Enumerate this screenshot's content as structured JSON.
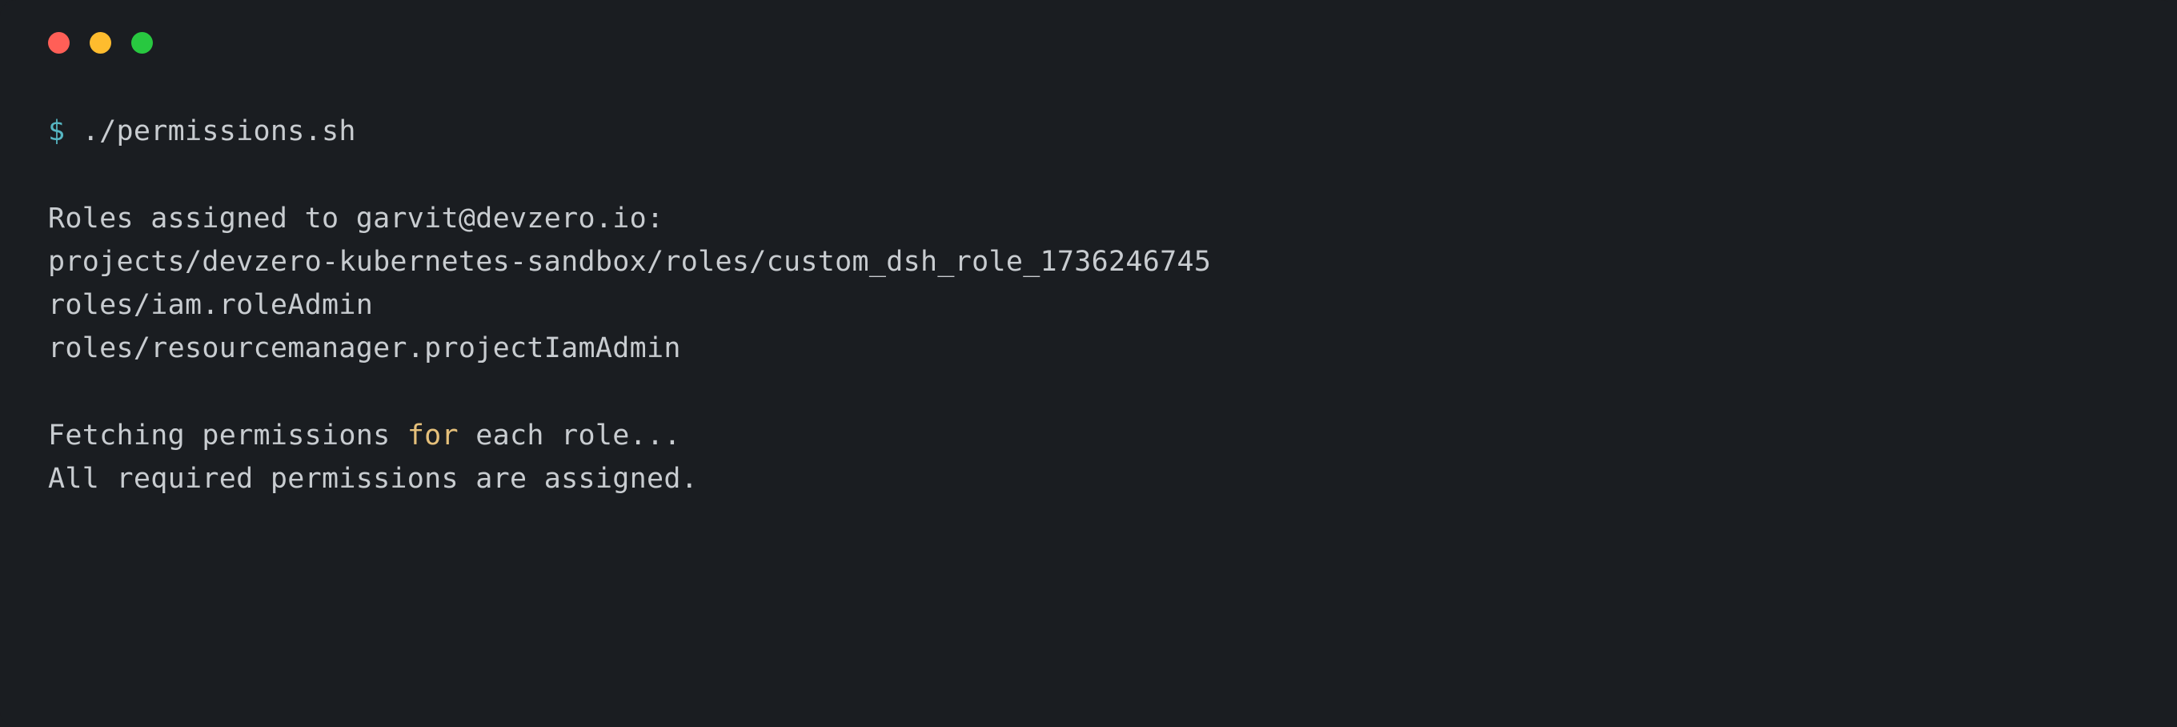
{
  "prompt": {
    "symbol": "$",
    "command": "./permissions.sh"
  },
  "output": {
    "roles_header": "Roles assigned to garvit@devzero.io:",
    "roles": [
      "projects/devzero-kubernetes-sandbox/roles/custom_dsh_role_1736246745",
      "roles/iam.roleAdmin",
      "roles/resourcemanager.projectIamAdmin"
    ],
    "fetching_prefix": "Fetching permissions ",
    "fetching_keyword": "for",
    "fetching_suffix": " each role...",
    "result": "All required permissions are assigned."
  },
  "colors": {
    "background": "#1a1d21",
    "text": "#c8ccd0",
    "prompt": "#56b6c2",
    "keyword": "#e5c07b",
    "red": "#ff5f57",
    "yellow": "#febc2e",
    "green": "#28c840"
  }
}
